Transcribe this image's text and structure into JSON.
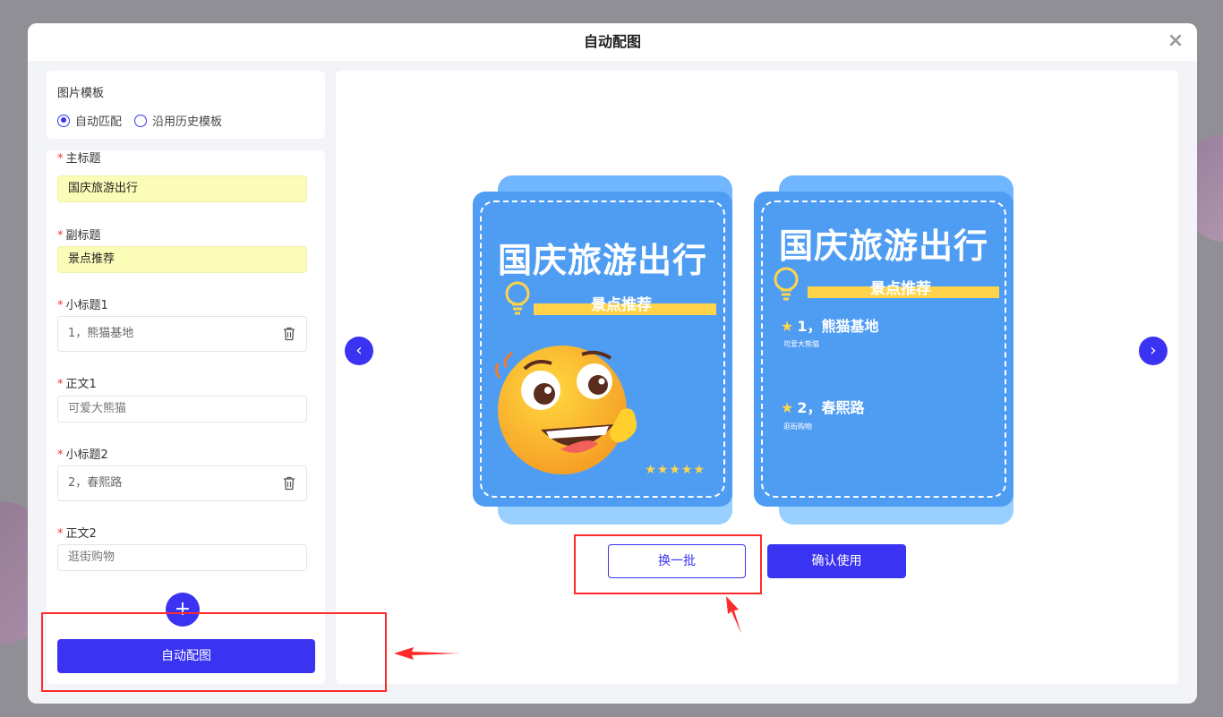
{
  "modal": {
    "title": "自动配图"
  },
  "template": {
    "label": "图片模板",
    "options": [
      {
        "label": "自动匹配",
        "checked": true
      },
      {
        "label": "沿用历史模板",
        "checked": false
      }
    ]
  },
  "form": {
    "fields": [
      {
        "label": "主标题",
        "value": "国庆旅游出行"
      },
      {
        "label": "副标题",
        "value": "景点推荐"
      },
      {
        "label": "小标题1",
        "value": "1，熊猫基地"
      },
      {
        "label": "正文1",
        "value": "可爱大熊猫"
      },
      {
        "label": "小标题2",
        "value": "2，春熙路"
      },
      {
        "label": "正文2",
        "value": "逛街购物"
      }
    ],
    "required_mark": "*",
    "add_symbol": "+",
    "auto_button": "自动配图"
  },
  "preview": {
    "left_arrow": "‹",
    "right_arrow": "›",
    "poster1": {
      "title": "国庆旅游出行",
      "subtitle": "景点推荐",
      "stars": "★★★★★"
    },
    "poster2": {
      "title": "国庆旅游出行",
      "subtitle": "景点推荐",
      "items": [
        {
          "title": "1，熊猫基地",
          "desc": "可爱大熊猫"
        },
        {
          "title": "2，春熙路",
          "desc": "逛街购物"
        }
      ]
    },
    "swap_button": "换一批",
    "confirm_button": "确认使用"
  },
  "colors": {
    "accent": "#3b33f2",
    "poster_blue": "#4f9df3",
    "highlight": "#fbfcb7",
    "annotation": "#ff2a2a"
  }
}
